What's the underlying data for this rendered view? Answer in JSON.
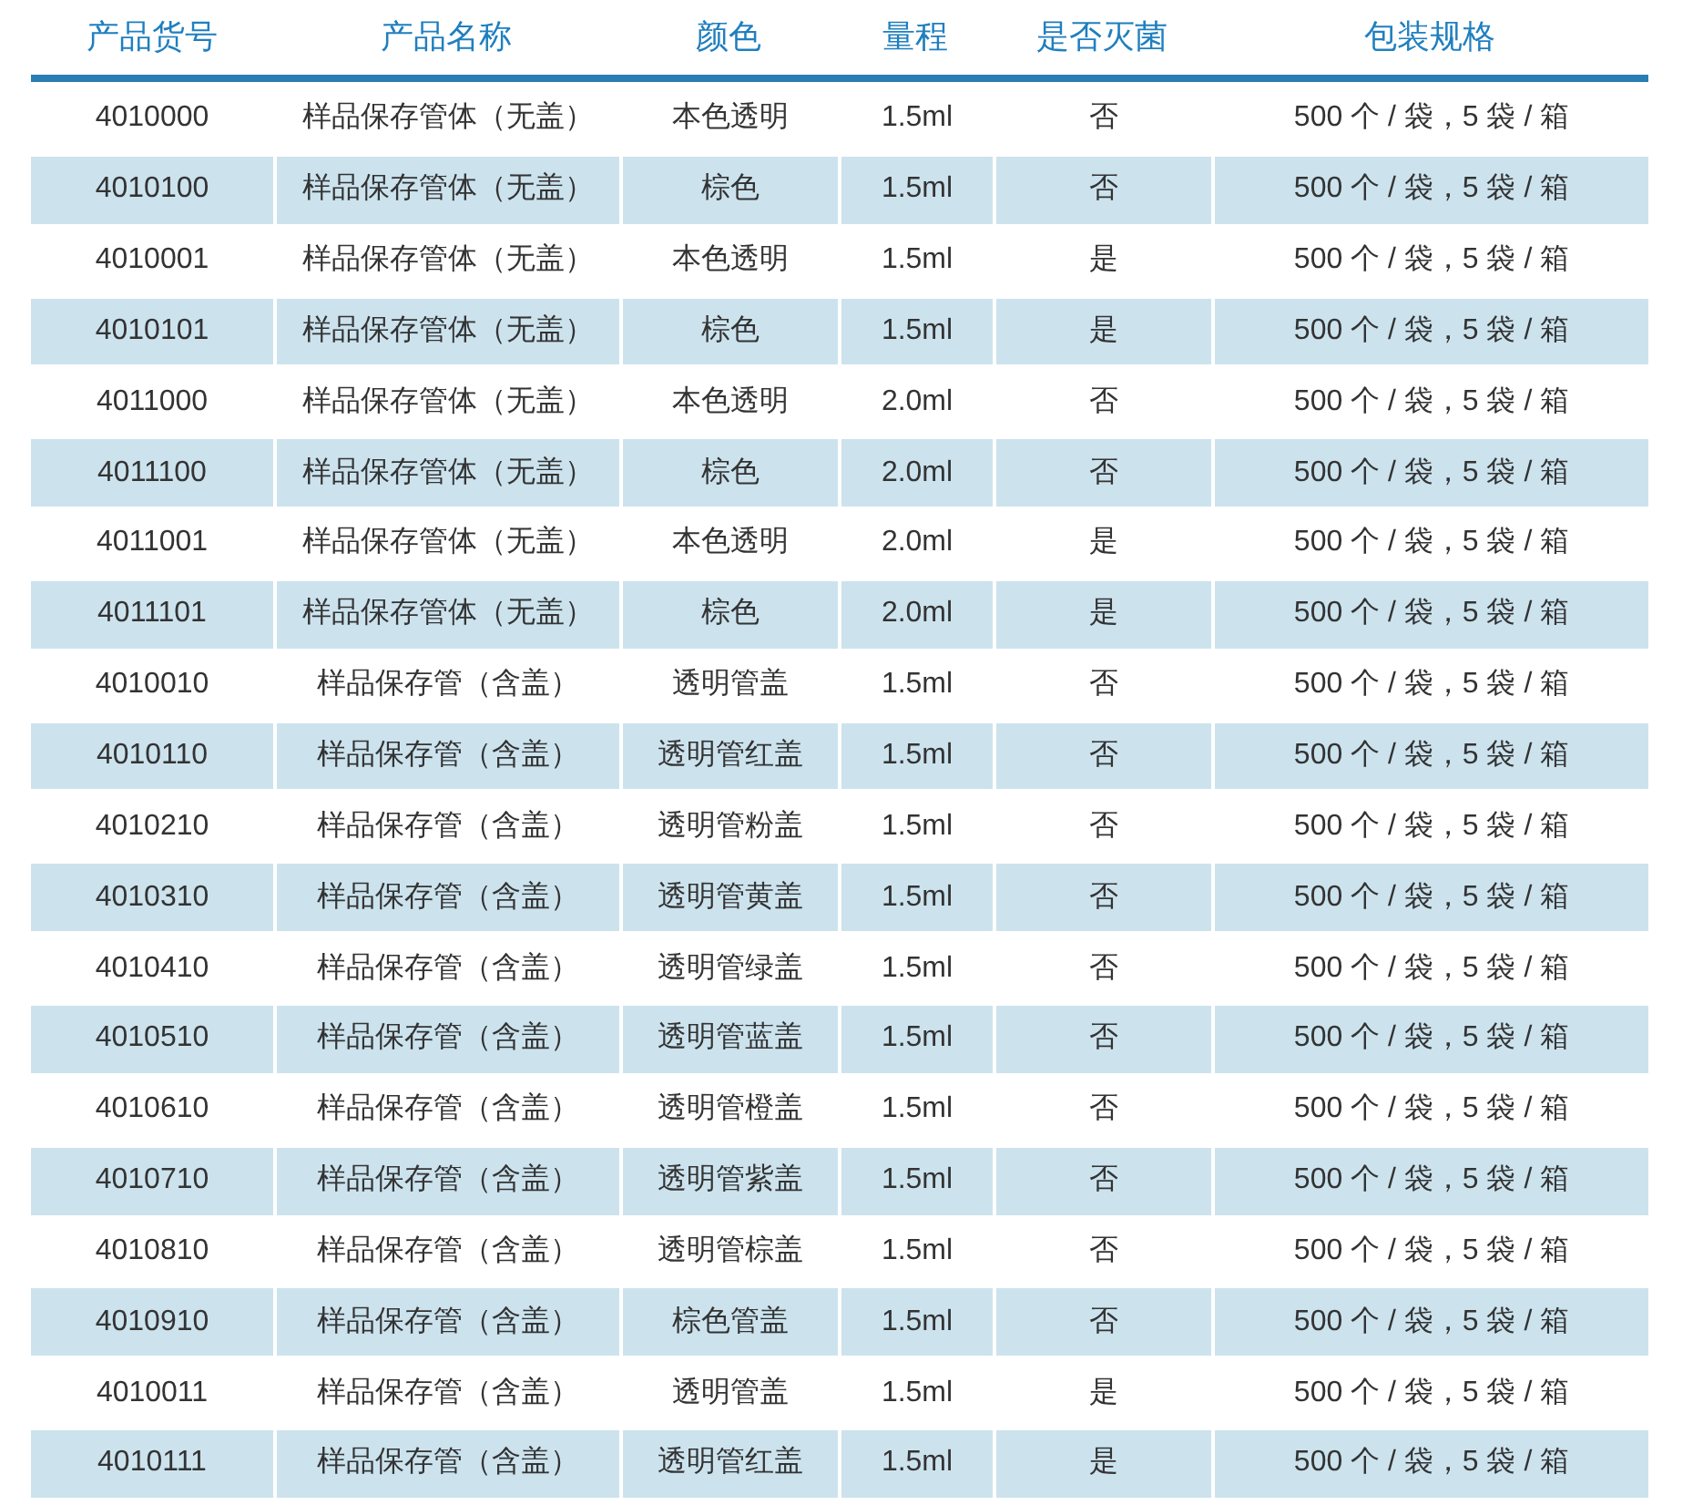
{
  "table": {
    "columns": [
      "产品货号",
      "产品名称",
      "颜色",
      "量程",
      "是否灭菌",
      "包装规格"
    ],
    "rows": [
      [
        "4010000",
        "样品保存管体（无盖）",
        "本色透明",
        "1.5ml",
        "否",
        "500 个 / 袋，5 袋 / 箱"
      ],
      [
        "4010100",
        "样品保存管体（无盖）",
        "棕色",
        "1.5ml",
        "否",
        "500 个 / 袋，5 袋 / 箱"
      ],
      [
        "4010001",
        "样品保存管体（无盖）",
        "本色透明",
        "1.5ml",
        "是",
        "500 个 / 袋，5 袋 / 箱"
      ],
      [
        "4010101",
        "样品保存管体（无盖）",
        "棕色",
        "1.5ml",
        "是",
        "500 个 / 袋，5 袋 / 箱"
      ],
      [
        "4011000",
        "样品保存管体（无盖）",
        "本色透明",
        "2.0ml",
        "否",
        "500 个 / 袋，5 袋 / 箱"
      ],
      [
        "4011100",
        "样品保存管体（无盖）",
        "棕色",
        "2.0ml",
        "否",
        "500 个 / 袋，5 袋 / 箱"
      ],
      [
        "4011001",
        "样品保存管体（无盖）",
        "本色透明",
        "2.0ml",
        "是",
        "500 个 / 袋，5 袋 / 箱"
      ],
      [
        "4011101",
        "样品保存管体（无盖）",
        "棕色",
        "2.0ml",
        "是",
        "500 个 / 袋，5 袋 / 箱"
      ],
      [
        "4010010",
        "样品保存管（含盖）",
        "透明管盖",
        "1.5ml",
        "否",
        "500 个 / 袋，5 袋 / 箱"
      ],
      [
        "4010110",
        "样品保存管（含盖）",
        "透明管红盖",
        "1.5ml",
        "否",
        "500 个 / 袋，5 袋 / 箱"
      ],
      [
        "4010210",
        "样品保存管（含盖）",
        "透明管粉盖",
        "1.5ml",
        "否",
        "500 个 / 袋，5 袋 / 箱"
      ],
      [
        "4010310",
        "样品保存管（含盖）",
        "透明管黄盖",
        "1.5ml",
        "否",
        "500 个 / 袋，5 袋 / 箱"
      ],
      [
        "4010410",
        "样品保存管（含盖）",
        "透明管绿盖",
        "1.5ml",
        "否",
        "500 个 / 袋，5 袋 / 箱"
      ],
      [
        "4010510",
        "样品保存管（含盖）",
        "透明管蓝盖",
        "1.5ml",
        "否",
        "500 个 / 袋，5 袋 / 箱"
      ],
      [
        "4010610",
        "样品保存管（含盖）",
        "透明管橙盖",
        "1.5ml",
        "否",
        "500 个 / 袋，5 袋 / 箱"
      ],
      [
        "4010710",
        "样品保存管（含盖）",
        "透明管紫盖",
        "1.5ml",
        "否",
        "500 个 / 袋，5 袋 / 箱"
      ],
      [
        "4010810",
        "样品保存管（含盖）",
        "透明管棕盖",
        "1.5ml",
        "否",
        "500 个 / 袋，5 袋 / 箱"
      ],
      [
        "4010910",
        "样品保存管（含盖）",
        "棕色管盖",
        "1.5ml",
        "否",
        "500 个 / 袋，5 袋 / 箱"
      ],
      [
        "4010011",
        "样品保存管（含盖）",
        "透明管盖",
        "1.5ml",
        "是",
        "500 个 / 袋，5 袋 / 箱"
      ],
      [
        "4010111",
        "样品保存管（含盖）",
        "透明管红盖",
        "1.5ml",
        "是",
        "500 个 / 袋，5 袋 / 箱"
      ]
    ]
  }
}
